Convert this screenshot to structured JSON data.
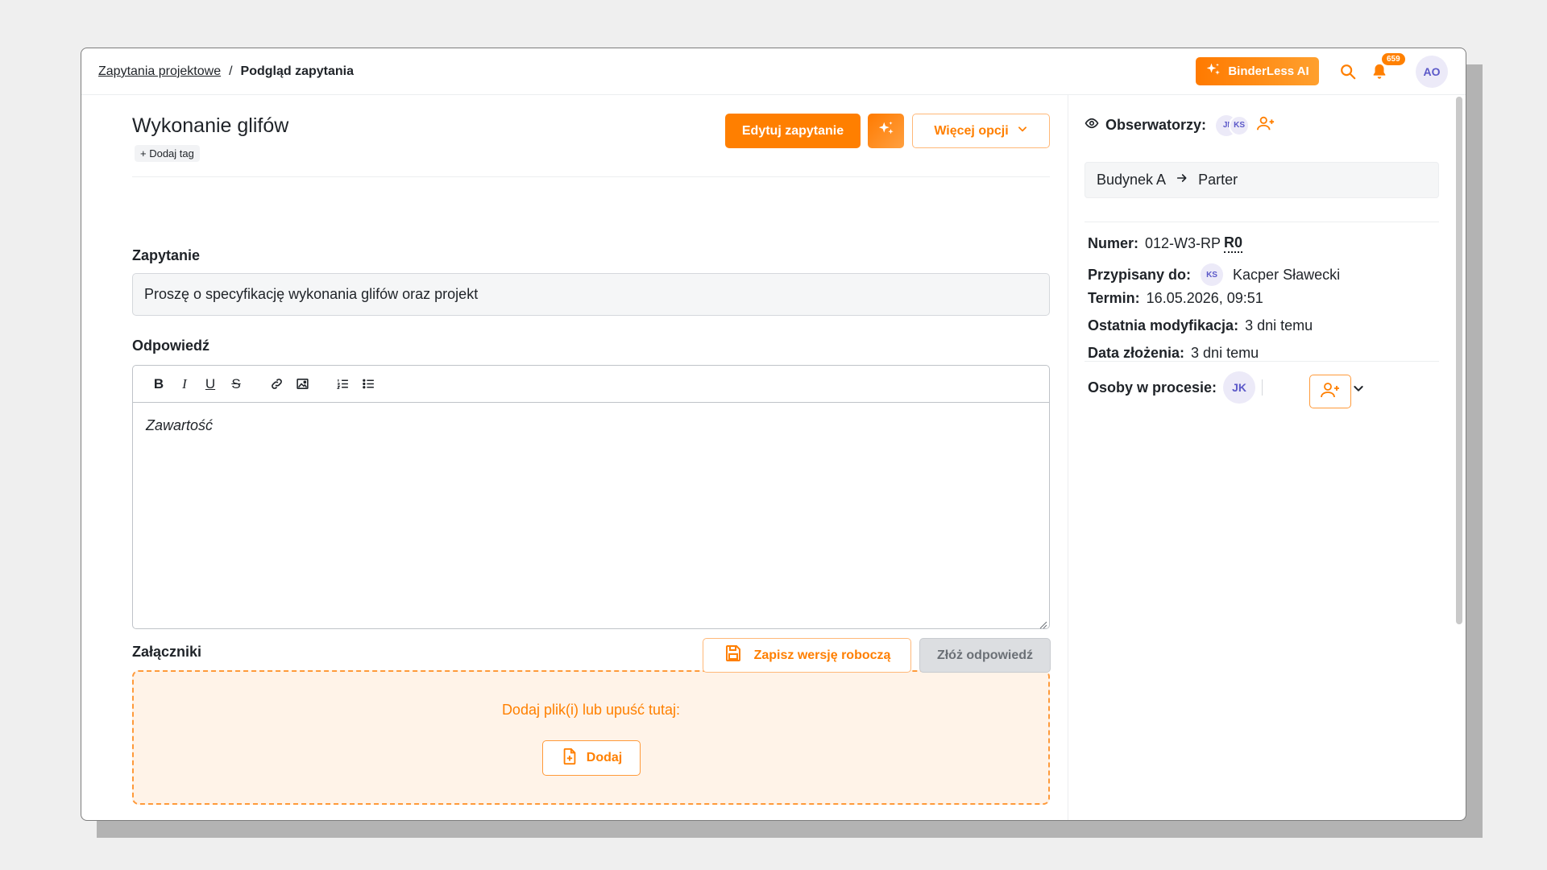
{
  "breadcrumb": {
    "parent": "Zapytania projektowe",
    "separator": "/",
    "current": "Podgląd zapytania"
  },
  "header": {
    "ai_label": "BinderLess AI",
    "notifications_count": "659",
    "user_initials": "AO"
  },
  "request": {
    "title": "Wykonanie glifów",
    "add_tag": "+ Dodaj tag",
    "edit_button": "Edytuj zapytanie",
    "more_button": "Więcej opcji"
  },
  "inquiry": {
    "label": "Zapytanie",
    "text": "Proszę o specyfikację wykonania glifów oraz projekt"
  },
  "answer": {
    "label": "Odpowiedź",
    "placeholder": "Zawartość",
    "toolbar": [
      "bold-icon",
      "italic-icon",
      "underline-icon",
      "strikethrough-icon",
      "link-icon",
      "image-icon",
      "ordered-list-icon",
      "bullet-list-icon"
    ]
  },
  "attachments": {
    "label": "Załączniki",
    "drop_text": "Dodaj plik(i) lub upuść tutaj:",
    "add_button": "Dodaj"
  },
  "footer": {
    "draft_button": "Zapisz wersję roboczą",
    "submit_button": "Złóż odpowiedź"
  },
  "side": {
    "observers_label": "Obserwatorzy:",
    "observers": [
      "JI",
      "KS"
    ],
    "location_from": "Budynek A",
    "location_to": "Parter",
    "number_label": "Numer:",
    "number_value": "012-W3-RP",
    "number_rev": "R0",
    "assigned_label": "Przypisany do:",
    "assigned_initials": "KS",
    "assigned_name": "Kacper Sławecki",
    "deadline_label": "Termin:",
    "deadline_value": "16.05.2026, 09:51",
    "modified_label": "Ostatnia modyfikacja:",
    "modified_value": "3 dni temu",
    "submitted_label": "Data złożenia:",
    "submitted_value": "3 dni temu",
    "people_label": "Osoby w procesie:",
    "people_initials": "JK"
  },
  "colors": {
    "accent": "#ff7f00",
    "avatar_bg": "#eceaf8",
    "avatar_fg": "#5b58c8"
  }
}
